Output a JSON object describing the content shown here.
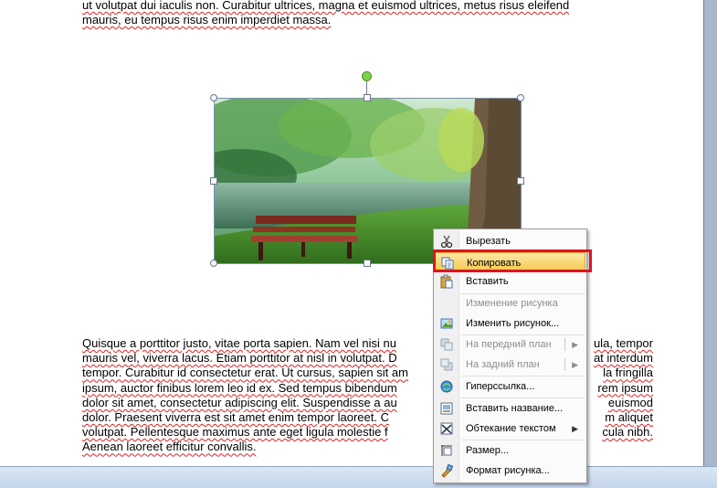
{
  "document": {
    "top_paragraph_lines": [
      "ut volutpat dui iaculis non. Curabitur ultrices, magna et euismod ultrices, metus risus eleifend",
      "mauris, eu tempus risus enim imperdiet massa."
    ],
    "bottom_paragraph_lines": [
      "Quisque a porttitor justo, vitae porta sapien. Nam vel nisi nu",
      "mauris vel, viverra lacus. Etiam porttitor at nisl in volutpat. D",
      "tempor. Curabitur id consectetur erat. Ut cursus, sapien sit am",
      "ipsum, auctor finibus lorem leo id ex. Sed tempus bibendum",
      "dolor sit amet, consectetur adipiscing elit. Suspendisse a au",
      "dolor. Praesent viverra est sit amet enim tempor laoreet. C",
      "volutpat. Pellentesque maximus ante eget ligula molestie f",
      "Aenean laoreet efficitur convallis."
    ],
    "bottom_paragraph_right_fragments": [
      "ula, tempor",
      "at interdum",
      "la fringilla",
      "rem ipsum",
      "euismod",
      "m aliquet",
      "cula nibh."
    ]
  },
  "context_menu": {
    "items": [
      {
        "label": "Вырезать",
        "icon": "scissors-icon",
        "enabled": true
      },
      {
        "label": "Копировать",
        "icon": "copy-icon",
        "enabled": true,
        "highlighted": true
      },
      {
        "label": "Вставить",
        "icon": "paste-icon",
        "enabled": true
      },
      {
        "label": "Изменение рисунка",
        "icon": "",
        "enabled": false
      },
      {
        "label": "Изменить рисунок...",
        "icon": "change-picture-icon",
        "enabled": true
      },
      {
        "label": "На передний план",
        "icon": "bring-to-front-icon",
        "enabled": false,
        "submenu": true
      },
      {
        "label": "На задний план",
        "icon": "send-to-back-icon",
        "enabled": false,
        "submenu": true
      },
      {
        "label": "Гиперссылка...",
        "icon": "hyperlink-icon",
        "enabled": true
      },
      {
        "label": "Вставить название...",
        "icon": "insert-caption-icon",
        "enabled": true
      },
      {
        "label": "Обтекание текстом",
        "icon": "text-wrapping-icon",
        "enabled": true,
        "submenu": true
      },
      {
        "label": "Размер...",
        "icon": "size-icon",
        "enabled": true
      },
      {
        "label": "Формат рисунка...",
        "icon": "format-picture-icon",
        "enabled": true
      }
    ]
  },
  "colors": {
    "highlight_box": "#e0141f",
    "menu_highlight": "#f6c74d",
    "rotate_handle": "#7ad14a"
  }
}
